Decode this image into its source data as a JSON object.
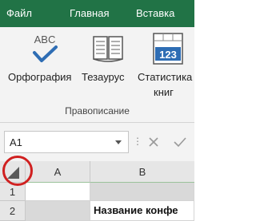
{
  "tabs": [
    {
      "label": "Файл"
    },
    {
      "label": "Главная"
    },
    {
      "label": "Вставка"
    }
  ],
  "ribbon": {
    "spelling": {
      "label": "Орфография",
      "icon": "spelling-check-icon",
      "icon_text": "ABC"
    },
    "thesaurus": {
      "label": "Тезаурус",
      "icon": "book-icon"
    },
    "stats": {
      "label_line1": "Статистика",
      "label_line2": "книг",
      "icon": "workbook-statistics-icon",
      "icon_text": "123"
    },
    "group_label": "Правописание"
  },
  "formula_bar": {
    "name_box": "A1",
    "cancel_icon": "x-icon",
    "enter_icon": "check-icon"
  },
  "grid": {
    "columns": [
      "A",
      "B"
    ],
    "rows": [
      "1",
      "2"
    ],
    "cells": {
      "B2": "Название конфе"
    }
  },
  "colors": {
    "accent": "#217346",
    "highlight_circle": "#d02020"
  }
}
